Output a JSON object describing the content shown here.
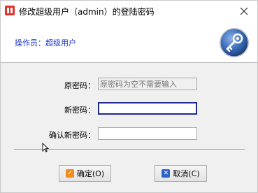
{
  "window": {
    "title": "修改超级用户（admin）的登陆密码"
  },
  "header": {
    "operator_label": "操作员：超级用户"
  },
  "form": {
    "old_password": {
      "label": "原密码：",
      "placeholder": "原密码为空不需要输入"
    },
    "new_password": {
      "label": "新密码：",
      "value": ""
    },
    "confirm_password": {
      "label": "确认新密码：",
      "value": ""
    }
  },
  "buttons": {
    "ok": {
      "label": "确定(O)"
    },
    "cancel": {
      "label": "取消(C)"
    }
  },
  "icons": {
    "app": "app-icon",
    "close": "close-icon",
    "key": "key-icon",
    "ok": "check-icon",
    "cancel": "x-icon",
    "cursor": "mouse-cursor-icon"
  },
  "colors": {
    "operator_label": "#1a35c8",
    "ok_icon": "#f08c1e",
    "cancel_icon": "#2c64c8",
    "key_badge": "#2f5fa8"
  }
}
